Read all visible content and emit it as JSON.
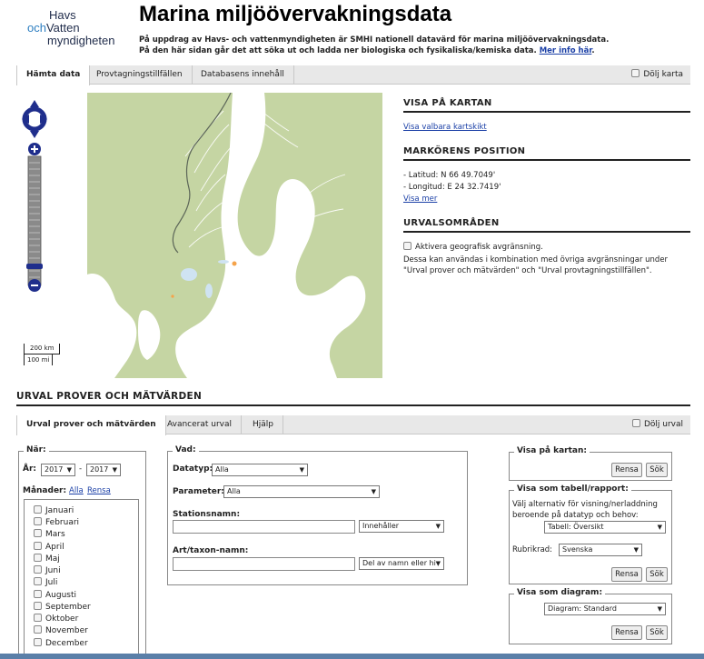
{
  "logo": {
    "line1": "Havs",
    "line2_och": "och",
    "line2_rest": "Vatten",
    "line3": "myndigheten"
  },
  "header": {
    "title": "Marina miljöövervakningsdata",
    "intro_line1": "På uppdrag av Havs- och vattenmyndigheten är SMHI nationell datavärd för marina miljöövervakningsdata.",
    "intro_line2": "På den här sidan går det att söka ut och ladda ner biologiska och fysikaliska/kemiska data.",
    "intro_link": "Mer info här",
    "intro_end": "."
  },
  "top_tabs": {
    "items": [
      "Hämta data",
      "Provtagningstillfällen",
      "Databasens innehåll"
    ],
    "hide_map": "Dölj karta"
  },
  "map": {
    "scale_km": "200 km",
    "scale_mi": "100 mi"
  },
  "right_panel": {
    "show_on_map": {
      "heading": "VISA PÅ KARTAN",
      "link": "Visa valbara kartskikt"
    },
    "marker": {
      "heading": "MARKÖRENS POSITION",
      "lat": "- Latitud: N 66 49.7049'",
      "lon": "- Longitud: E 24 32.7419'",
      "more": "Visa mer"
    },
    "areas": {
      "heading": "URVALSOMRÅDEN",
      "checkbox": "Aktivera geografisk avgränsning.",
      "desc1": "Dessa kan användas i kombination med övriga avgränsningar under",
      "desc2": "\"Urval prover och mätvärden\" och \"Urval provtagningstillfällen\"."
    }
  },
  "section_heading": "URVAL PROVER OCH MÄTVÄRDEN",
  "sub_tabs": {
    "items": [
      "Urval prover och mätvärden",
      "Avancerat urval",
      "Hjälp"
    ],
    "hide_selection": "Dölj urval"
  },
  "nar": {
    "legend": "När:",
    "year_label": "År:",
    "year_from": "2017",
    "dash": "-",
    "year_to": "2017",
    "months_label": "Månader:",
    "all": "Alla",
    "clear": "Rensa",
    "months": [
      "Januari",
      "Februari",
      "Mars",
      "April",
      "Maj",
      "Juni",
      "Juli",
      "Augusti",
      "September",
      "Oktober",
      "November",
      "December"
    ]
  },
  "vad": {
    "legend": "Vad:",
    "datatype_label": "Datatyp:",
    "datatype_value": "Alla",
    "parameter_label": "Parameter:",
    "parameter_value": "Alla",
    "station_label": "Stationsnamn:",
    "station_mode": "Innehåller",
    "taxon_label": "Art/taxon-namn:",
    "taxon_mode": "Del av namn eller hi"
  },
  "visa_karta": {
    "legend": "Visa på kartan:",
    "clear": "Rensa",
    "search": "Sök"
  },
  "visa_tabell": {
    "legend": "Visa som tabell/rapport:",
    "desc1": "Välj alternativ för visning/nerladdning",
    "desc2": "beroende på datatyp och behov:",
    "table_value": "Tabell: Översikt",
    "row_label": "Rubrikrad:",
    "row_value": "Svenska",
    "clear": "Rensa",
    "search": "Sök"
  },
  "visa_diagram": {
    "legend": "Visa som diagram:",
    "value": "Diagram: Standard",
    "clear": "Rensa",
    "search": "Sök"
  },
  "colors": {
    "land": "#c5d5a3",
    "sea": "#ffffff",
    "lake": "#cfe3f2",
    "zoom": "#1f2e8c",
    "link": "#1a3fa6"
  }
}
